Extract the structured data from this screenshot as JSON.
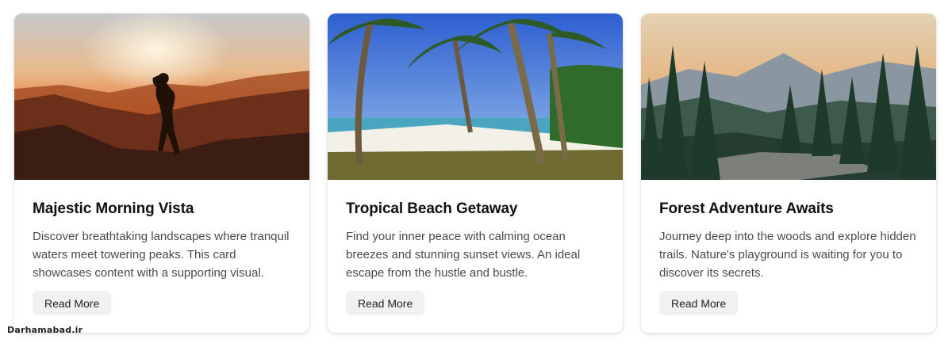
{
  "cards": [
    {
      "image_name": "mountain-sunrise-silhouette-image",
      "title": "Majestic Morning Vista",
      "text": "Discover breathtaking landscapes where tranquil waters meet towering peaks. This card showcases content with a supporting visual.",
      "button_label": "Read More"
    },
    {
      "image_name": "tropical-beach-palms-image",
      "title": "Tropical Beach Getaway",
      "text": "Find your inner peace with calming ocean breezes and stunning sunset views. An ideal escape from the hustle and bustle.",
      "button_label": "Read More"
    },
    {
      "image_name": "forest-mountains-image",
      "title": "Forest Adventure Awaits",
      "text": "Journey deep into the woods and explore hidden trails. Nature's playground is waiting for you to discover its secrets.",
      "button_label": "Read More"
    }
  ],
  "watermark": "Darhamabad.ir",
  "colors": {
    "button_bg": "#f0f1f3",
    "title": "#111111",
    "text": "#4a4a4a"
  }
}
